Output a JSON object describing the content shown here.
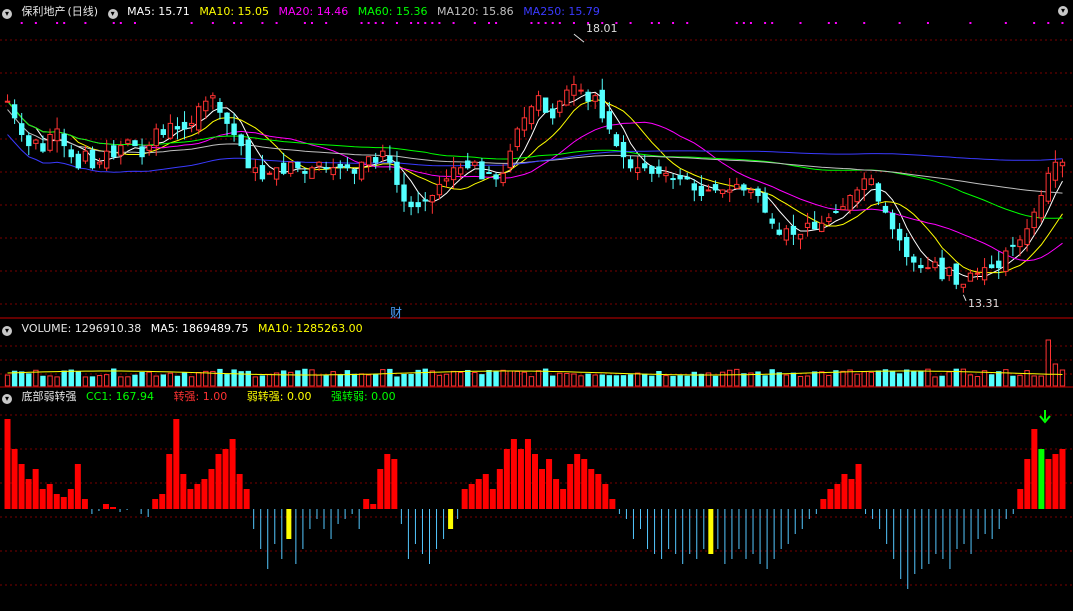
{
  "colors": {
    "up": "#ff3232",
    "down": "#54ffff",
    "grid": "#7a0000",
    "ma5": "#ffffff",
    "ma10": "#ffff00",
    "ma20": "#ff00ff",
    "ma60": "#00ff00",
    "ma120": "#c0c0c0",
    "ma250": "#3a3aff",
    "strong": "#ff0000",
    "weak": "#ffff00",
    "flip": "#00ff00",
    "neg": "#54c8ff"
  },
  "price_panel": {
    "stock_name": "保利地产",
    "period": "(日线)",
    "ma5": "MA5: 15.71",
    "ma10": "MA10: 15.05",
    "ma20": "MA20: 14.46",
    "ma60": "MA60: 15.36",
    "ma120": "MA120: 15.86",
    "ma250": "MA250: 15.79",
    "high_label": "18.01",
    "low_label": "13.31",
    "event_marker": "财"
  },
  "volume_panel": {
    "label": "VOLUME: 1296910.38",
    "ma5": "MA5: 1869489.75",
    "ma10": "MA10: 1285263.00"
  },
  "indicator_panel": {
    "name": "底部弱转强",
    "cc1": "CC1: 167.94",
    "strong": "转强: 1.00",
    "weak_to_strong": "弱转强: 0.00",
    "strong_to_weak": "强转弱: 0.00"
  },
  "chart_data": [
    {
      "type": "candlestick",
      "title": "保利地产 (日线)",
      "y_range": [
        13.0,
        18.3
      ],
      "annotations": [
        {
          "text": "18.01",
          "bar_index": 80
        },
        {
          "text": "13.31",
          "bar_index": 135
        }
      ],
      "closes": [
        16.8,
        16.5,
        16.2,
        16.0,
        16.1,
        15.9,
        16.2,
        16.3,
        16.0,
        15.8,
        15.6,
        15.9,
        15.6,
        15.7,
        15.9,
        15.8,
        16.0,
        16.1,
        16.0,
        15.8,
        16.0,
        16.3,
        16.2,
        16.4,
        16.3,
        16.3,
        16.4,
        16.7,
        16.8,
        16.9,
        16.6,
        16.4,
        16.2,
        16.0,
        15.6,
        15.6,
        15.4,
        15.5,
        15.6,
        15.5,
        15.7,
        15.6,
        15.5,
        15.6,
        15.7,
        15.6,
        15.6,
        15.6,
        15.6,
        15.5,
        15.7,
        15.8,
        15.7,
        15.9,
        15.7,
        15.3,
        15.0,
        14.9,
        14.9,
        15.0,
        15.1,
        15.3,
        15.4,
        15.6,
        15.6,
        15.6,
        15.7,
        15.4,
        15.5,
        15.4,
        15.5,
        15.9,
        16.3,
        16.5,
        16.7,
        16.9,
        16.6,
        16.5,
        16.8,
        17.0,
        17.1,
        17.0,
        16.8,
        16.9,
        16.5,
        16.3,
        16.0,
        15.8,
        15.6,
        15.6,
        15.6,
        15.5,
        15.5,
        15.5,
        15.4,
        15.4,
        15.4,
        15.2,
        15.1,
        15.2,
        15.2,
        15.2,
        15.2,
        15.3,
        15.2,
        15.2,
        15.1,
        14.8,
        14.6,
        14.4,
        14.5,
        14.4,
        14.4,
        14.6,
        14.5,
        14.6,
        14.7,
        14.8,
        14.9,
        15.1,
        15.2,
        15.4,
        15.4,
        15.0,
        14.8,
        14.5,
        14.3,
        14.0,
        13.9,
        13.8,
        13.8,
        13.9,
        13.6,
        13.8,
        13.5,
        13.5,
        13.7,
        13.7,
        13.8,
        13.8,
        13.8,
        14.1,
        14.2,
        14.3,
        14.5,
        14.8,
        15.1,
        15.5,
        15.7,
        15.7
      ],
      "ma_lines": [
        "MA5",
        "MA10",
        "MA20",
        "MA60",
        "MA120",
        "MA250"
      ]
    },
    {
      "type": "bar",
      "title": "VOLUME",
      "series": [
        {
          "name": "VOLUME",
          "values_relative": "scaled"
        }
      ]
    },
    {
      "type": "bar",
      "title": "底部弱转强",
      "values": [
        90,
        60,
        45,
        30,
        40,
        20,
        25,
        15,
        12,
        20,
        45,
        10,
        -5,
        -2,
        5,
        2,
        -3,
        -1,
        0,
        -5,
        -8,
        10,
        15,
        55,
        90,
        35,
        20,
        25,
        30,
        40,
        55,
        60,
        70,
        35,
        20,
        -20,
        -40,
        -60,
        -35,
        -50,
        -30,
        -55,
        -40,
        -20,
        -10,
        -20,
        -30,
        -15,
        -10,
        -5,
        -20,
        10,
        5,
        40,
        55,
        50,
        -15,
        -50,
        -35,
        -45,
        -55,
        -40,
        -30,
        -20,
        -10,
        20,
        25,
        30,
        35,
        20,
        40,
        60,
        70,
        60,
        70,
        55,
        40,
        50,
        30,
        20,
        45,
        55,
        50,
        40,
        35,
        25,
        10,
        -5,
        -10,
        -30,
        -20,
        -40,
        -45,
        -50,
        -40,
        -45,
        -55,
        -45,
        -50,
        -40,
        -45,
        -40,
        -55,
        -50,
        -40,
        -50,
        -45,
        -55,
        -60,
        -50,
        -40,
        -35,
        -25,
        -20,
        -10,
        -5,
        10,
        20,
        25,
        35,
        30,
        45,
        -5,
        -10,
        -20,
        -35,
        -50,
        -70,
        -80,
        -65,
        -60,
        -55,
        -45,
        -50,
        -60,
        -40,
        -35,
        -45,
        -30,
        -25,
        -30,
        -20,
        -10,
        -5,
        20,
        50,
        80,
        60,
        50,
        55,
        60
      ],
      "yellow_bars": [
        40,
        63,
        100
      ]
    }
  ]
}
